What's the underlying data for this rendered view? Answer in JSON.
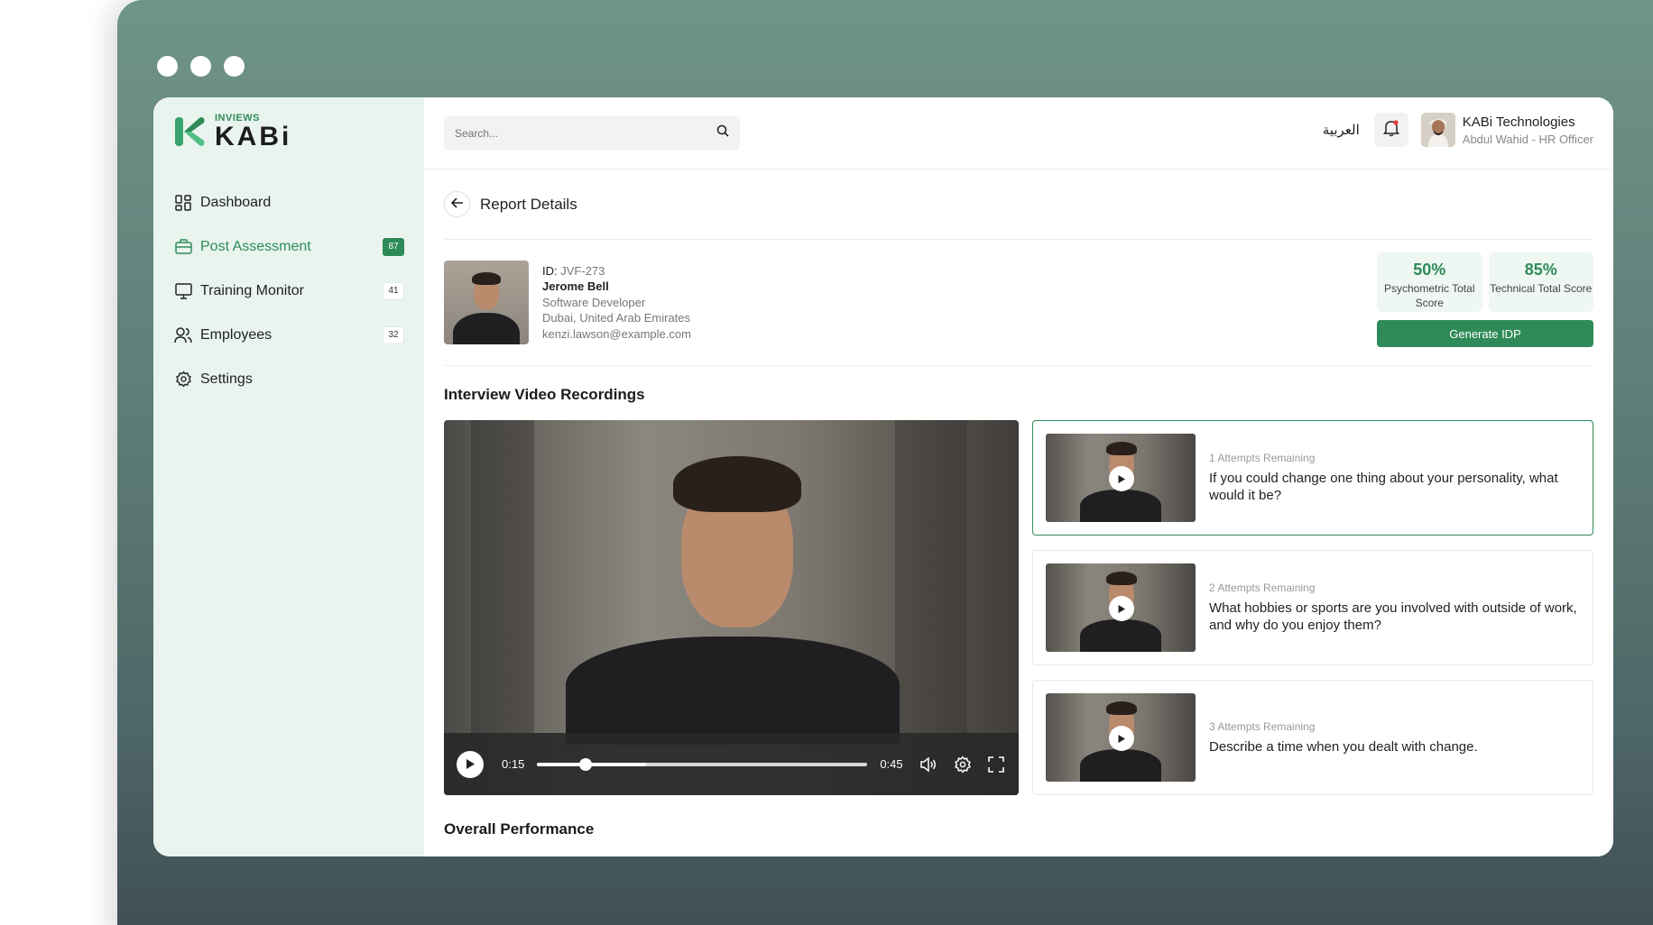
{
  "sidebar": {
    "logo_small": "INVIEWS",
    "logo_big": "KABi",
    "items": [
      {
        "label": "Dashboard",
        "icon": "grid-icon",
        "badge": ""
      },
      {
        "label": "Post Assessment",
        "icon": "briefcase-icon",
        "badge": "87"
      },
      {
        "label": "Training Monitor",
        "icon": "monitor-icon",
        "badge": "41"
      },
      {
        "label": "Employees",
        "icon": "users-icon",
        "badge": "32"
      },
      {
        "label": "Settings",
        "icon": "gear-icon",
        "badge": ""
      }
    ]
  },
  "header": {
    "search_placeholder": "Search...",
    "language": "العربية",
    "org_name": "KABi Technologies",
    "user_role": "Abdul Wahid - HR Officer"
  },
  "page": {
    "title": "Report Details"
  },
  "profile": {
    "id_label": "ID:",
    "id_value": "JVF-273",
    "name": "Jerome Bell",
    "position": "Software Developer",
    "location": "Dubai, United Arab Emirates",
    "email": "kenzi.lawson@example.com"
  },
  "scores": {
    "psychometric_value": "50%",
    "psychometric_label": "Psychometric Total Score",
    "technical_value": "85%",
    "technical_label": "Technical Total Score",
    "generate_label": "Generate IDP"
  },
  "videos": {
    "section_title": "Interview Video Recordings",
    "player": {
      "current_time": "0:15",
      "duration": "0:45",
      "progress": 0.33
    },
    "questions": [
      {
        "attempts": "1 Attempts Remaining",
        "question": "If you could change one thing about your personality, what would it be?"
      },
      {
        "attempts": "2 Attempts Remaining",
        "question": "What hobbies or sports are you involved with outside of work, and why do you enjoy them?"
      },
      {
        "attempts": "3 Attempts Remaining",
        "question": "Describe a time when you dealt with change."
      }
    ]
  },
  "overall": {
    "title": "Overall Performance"
  },
  "colors": {
    "brand": "#2e8b57",
    "sidebar_bg": "#e9f4ef"
  }
}
